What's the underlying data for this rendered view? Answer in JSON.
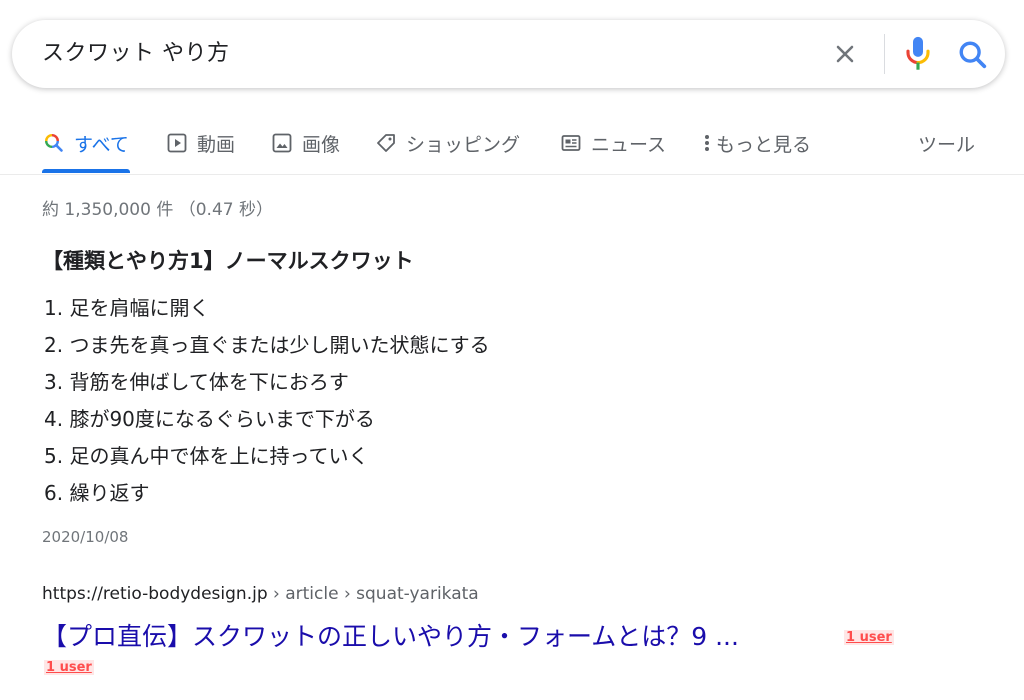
{
  "search": {
    "query": "スクワット やり方"
  },
  "icons": {
    "clear": "close-icon",
    "mic": "microphone-icon",
    "search": "search-icon"
  },
  "colors": {
    "accent": "#1a73e8",
    "link": "#1a0dab",
    "badge": "#ff4d4d"
  },
  "tabs": [
    {
      "label": "すべて",
      "icon": "search-icon",
      "active": true
    },
    {
      "label": "動画",
      "icon": "video-icon",
      "active": false
    },
    {
      "label": "画像",
      "icon": "image-icon",
      "active": false
    },
    {
      "label": "ショッピング",
      "icon": "tag-icon",
      "active": false
    },
    {
      "label": "ニュース",
      "icon": "newspaper-icon",
      "active": false
    },
    {
      "label": "もっと見る",
      "icon": "more-vertical-icon",
      "active": false
    },
    {
      "label": "ツール",
      "icon": "",
      "active": false
    }
  ],
  "result_stats": "約 1,350,000 件 （0.47 秒）",
  "snippet": {
    "heading": "【種類とやり方1】ノーマルスクワット",
    "steps": [
      "1. 足を肩幅に開く",
      "2. つま先を真っ直ぐまたは少し開いた状態にする",
      "3. 背筋を伸ばして体を下におろす",
      "4. 膝が90度になるぐらいまで下がる",
      "5. 足の真ん中で体を上に持っていく",
      "6. 繰り返す"
    ],
    "date": "2020/10/08"
  },
  "result": {
    "domain": "https://retio-bodydesign.jp",
    "breadcrumb": " › article › squat-yarikata",
    "title": "【プロ直伝】スクワットの正しいやり方・フォームとは？9 ...",
    "badge_1": "1 user",
    "badge_2": "1 user"
  }
}
